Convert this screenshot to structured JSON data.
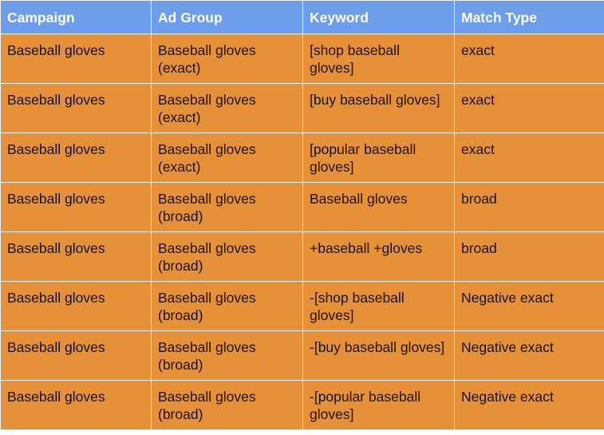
{
  "colors": {
    "header_bg": "#6d9eeb",
    "cell_bg": "#e69138",
    "border": "#ffffff"
  },
  "table": {
    "headers": [
      "Campaign",
      "Ad Group",
      "Keyword",
      "Match Type"
    ],
    "rows": [
      [
        "Baseball gloves",
        "Baseball gloves (exact)",
        "[shop baseball gloves]",
        "exact"
      ],
      [
        "Baseball gloves",
        "Baseball gloves (exact)",
        "[buy baseball gloves]",
        "exact"
      ],
      [
        "Baseball gloves",
        "Baseball gloves (exact)",
        "[popular baseball gloves]",
        "exact"
      ],
      [
        "Baseball gloves",
        "Baseball gloves (broad)",
        "Baseball gloves",
        "broad"
      ],
      [
        "Baseball gloves",
        "Baseball gloves (broad)",
        "+baseball +gloves",
        "broad"
      ],
      [
        "Baseball gloves",
        "Baseball gloves (broad)",
        "-[shop baseball gloves]",
        "Negative exact"
      ],
      [
        "Baseball gloves",
        "Baseball gloves (broad)",
        "-[buy baseball gloves]",
        "Negative exact"
      ],
      [
        "Baseball gloves",
        "Baseball gloves (broad)",
        "-[popular baseball gloves]",
        "Negative exact"
      ]
    ]
  }
}
